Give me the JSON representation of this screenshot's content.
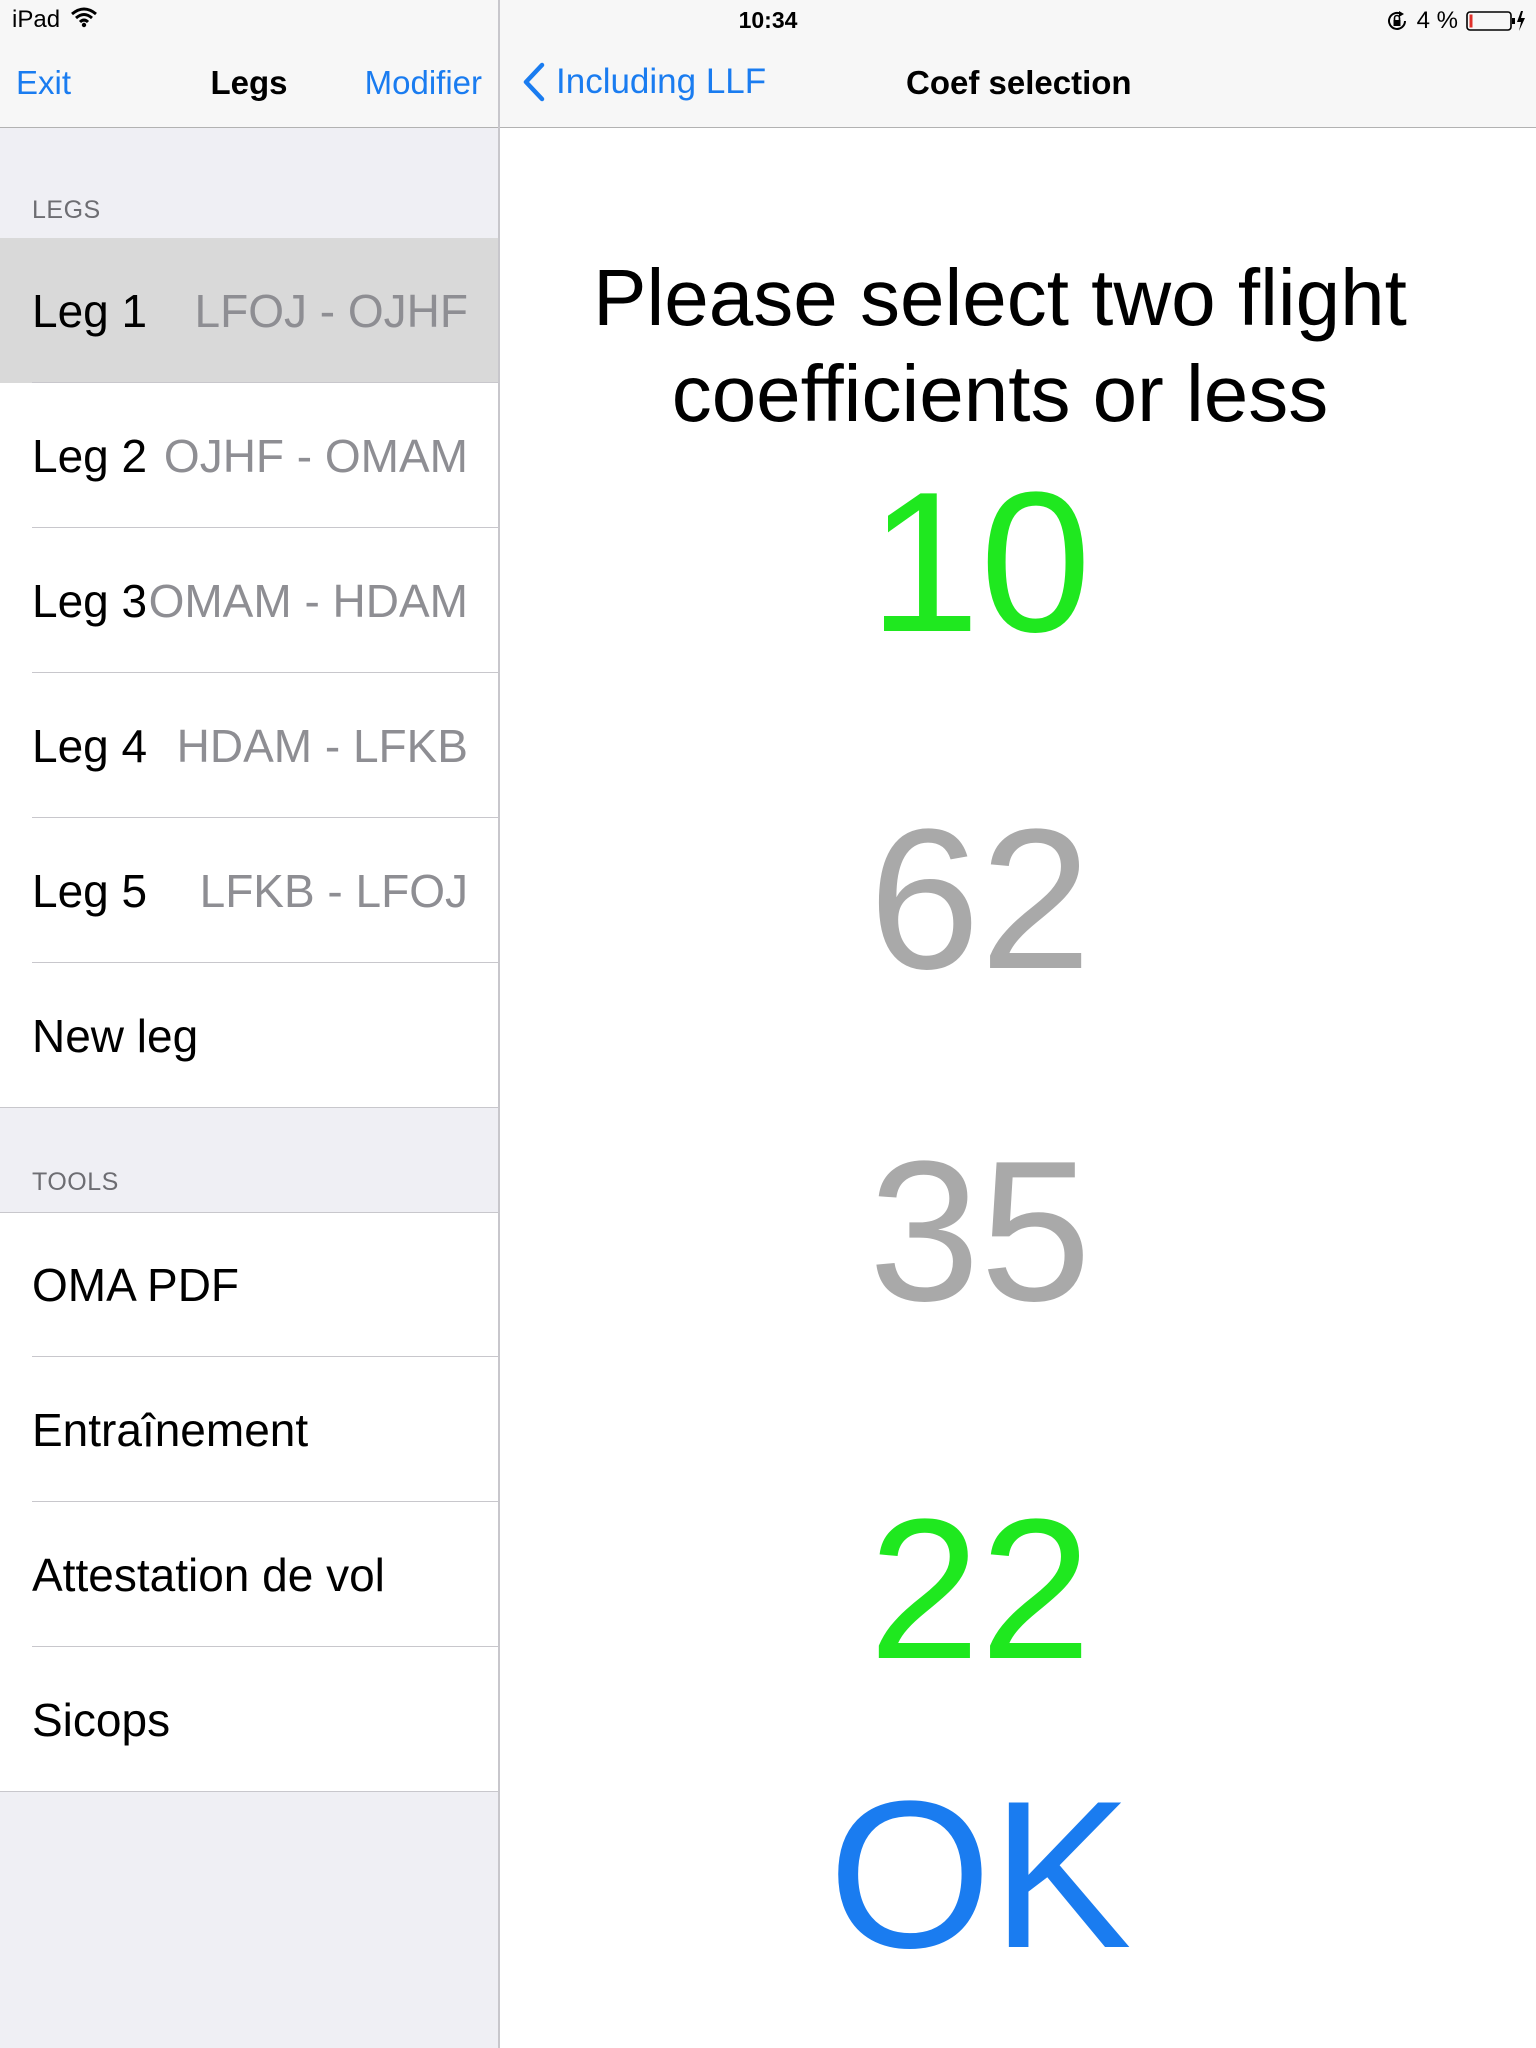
{
  "status_bar": {
    "device": "iPad",
    "time": "10:34",
    "battery": "4 %"
  },
  "master": {
    "nav": {
      "left_button": "Exit",
      "title": "Legs",
      "right_button": "Modifier"
    },
    "legs_header": "LEGS",
    "legs": [
      {
        "label": "Leg 1",
        "route": "LFOJ - OJHF",
        "selected": true
      },
      {
        "label": "Leg 2",
        "route": "OJHF - OMAM",
        "selected": false
      },
      {
        "label": "Leg 3",
        "route": "OMAM - HDAM",
        "selected": false
      },
      {
        "label": "Leg 4",
        "route": "HDAM - LFKB",
        "selected": false
      },
      {
        "label": "Leg 5",
        "route": "LFKB - LFOJ",
        "selected": false
      },
      {
        "label": "New leg",
        "route": "",
        "selected": false
      }
    ],
    "tools_header": "TOOLS",
    "tools": [
      {
        "label": "OMA PDF"
      },
      {
        "label": "Entraînement"
      },
      {
        "label": "Attestation de vol"
      },
      {
        "label": "Sicops"
      }
    ]
  },
  "detail": {
    "back_label": "Including LLF",
    "title": "Coef selection",
    "prompt_line1": "Please select two flight",
    "prompt_line2": "coefficients or less",
    "coefficients": [
      {
        "value": "10",
        "selected": true
      },
      {
        "value": "62",
        "selected": false
      },
      {
        "value": "35",
        "selected": false
      },
      {
        "value": "22",
        "selected": true
      }
    ],
    "ok_label": "OK"
  },
  "colors": {
    "accent_blue": "#1a7cf0",
    "selected_green": "#1fe81f",
    "unselected_gray": "#a9a9a9",
    "battery_red": "#e0302a"
  }
}
